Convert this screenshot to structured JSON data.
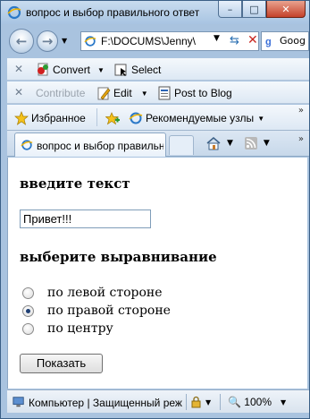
{
  "window": {
    "title": "вопрос и выбор правильного ответ",
    "minimize_glyph": "–",
    "maximize_glyph": "□",
    "close_glyph": "✕"
  },
  "nav": {
    "address": "F:\\DOCUMS\\Jenny\\",
    "search_text": "Goog"
  },
  "toolbar1": {
    "convert_label": "Convert",
    "select_label": "Select"
  },
  "toolbar2": {
    "contribute_label": "Contribute",
    "edit_label": "Edit",
    "post_label": "Post to Blog"
  },
  "favorites_bar": {
    "favorites_label": "Избранное",
    "suggested_label": "Рекомендуемые узлы"
  },
  "tab": {
    "label": "вопрос и выбор правильного ответа"
  },
  "form": {
    "heading_text": "введите текст",
    "text_value": "Привет!!!",
    "heading_align": "выберите выравнивание",
    "options": [
      {
        "label": "по левой стороне",
        "checked": false
      },
      {
        "label": "по правой стороне",
        "checked": true
      },
      {
        "label": "по центру",
        "checked": false
      }
    ],
    "button_label": "Показать"
  },
  "status": {
    "zone_text": "Компьютер | Защищенный режим: вкл.",
    "zoom_text": "100%"
  },
  "icons": {
    "ie": "ie-logo-icon",
    "convert": "convert-pdf-icon",
    "select": "select-icon",
    "edit": "edit-icon",
    "post": "post-to-blog-icon",
    "favorites": "favorites-star-icon",
    "add_favorites": "add-favorites-icon",
    "home": "home-icon",
    "rss": "rss-icon"
  }
}
